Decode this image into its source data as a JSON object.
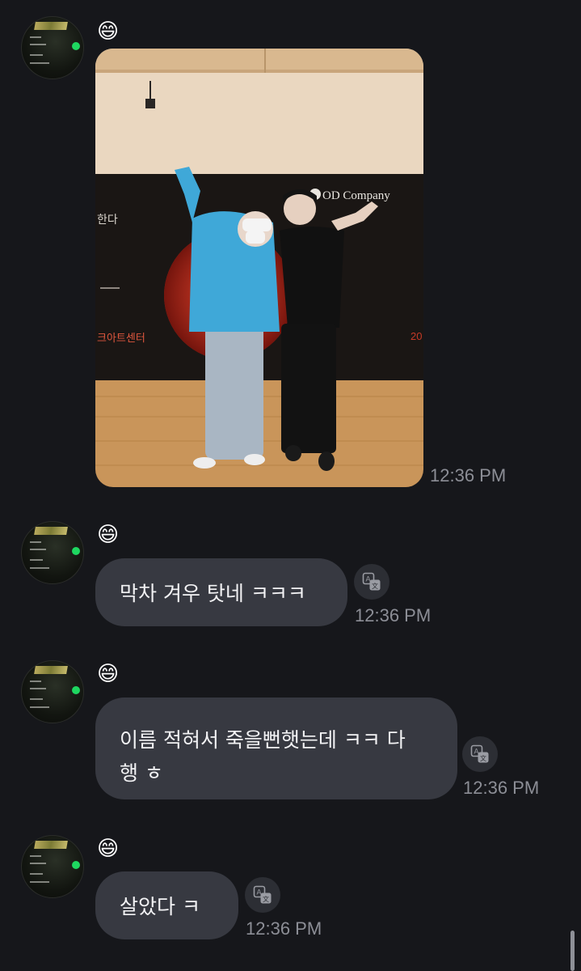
{
  "messages": [
    {
      "type": "image",
      "emoji": "😄",
      "time": "12:36 PM",
      "photo": {
        "backdrop_brand": "OD Company",
        "backdrop_side_text": "한다",
        "backdrop_venue": "크아트센터",
        "backdrop_year_fragment": "20"
      }
    },
    {
      "type": "text",
      "emoji": "😄",
      "text": "막차 겨우 탓네 ㅋㅋㅋ",
      "time": "12:36 PM"
    },
    {
      "type": "text",
      "emoji": "😄",
      "text": "이름 적혀서 죽을뻔햇는데 ㅋㅋ 다\n행 ㅎ",
      "time": "12:36 PM"
    },
    {
      "type": "text",
      "emoji": "😄",
      "text": "살았다 ㅋ",
      "time": "12:36 PM"
    }
  ],
  "avatar": {
    "title": "ALIVE",
    "accent": "#1ed760"
  },
  "colors": {
    "background": "#16171b",
    "bubble": "#373941",
    "timestamp": "#8c8e96"
  },
  "icons": {
    "avatar": "profile-avatar",
    "translate": "translate-icon",
    "reaction": "grinning-face-emoji"
  }
}
